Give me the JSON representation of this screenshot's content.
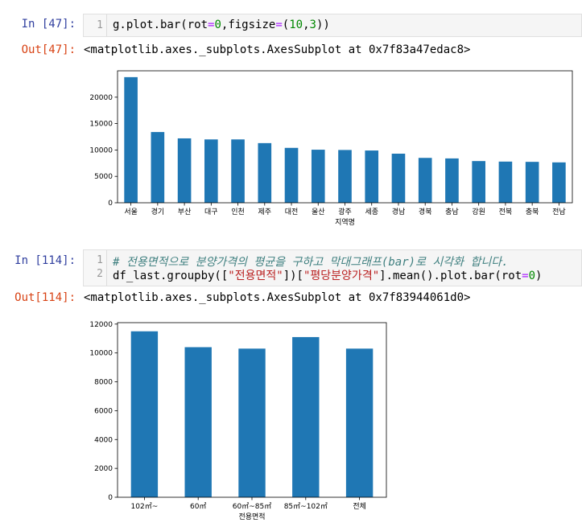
{
  "cells": [
    {
      "in_prompt": "In [47]:",
      "out_prompt": "Out[47]:",
      "line_numbers": [
        "1"
      ],
      "code_tokens": [
        [
          {
            "t": "g.plot.bar(rot",
            "c": ""
          },
          {
            "t": "=",
            "c": "op"
          },
          {
            "t": "0",
            "c": "num"
          },
          {
            "t": ",figsize",
            "c": ""
          },
          {
            "t": "=",
            "c": "op"
          },
          {
            "t": "(",
            "c": ""
          },
          {
            "t": "10",
            "c": "num"
          },
          {
            "t": ",",
            "c": ""
          },
          {
            "t": "3",
            "c": "num"
          },
          {
            "t": "))",
            "c": ""
          }
        ]
      ],
      "output_text": "<matplotlib.axes._subplots.AxesSubplot at 0x7f83a47edac8>"
    },
    {
      "in_prompt": "In [114]:",
      "out_prompt": "Out[114]:",
      "line_numbers": [
        "1",
        "2"
      ],
      "code_tokens": [
        [
          {
            "t": "# 전용면적으로 분양가격의 평균을 구하고 막대그래프(bar)로 시각화 합니다.",
            "c": "com"
          }
        ],
        [
          {
            "t": "df_last.groupby([",
            "c": ""
          },
          {
            "t": "\"전용면적\"",
            "c": "str"
          },
          {
            "t": "])[",
            "c": ""
          },
          {
            "t": "\"평당분양가격\"",
            "c": "str"
          },
          {
            "t": "].mean().plot.bar(rot",
            "c": ""
          },
          {
            "t": "=",
            "c": "op"
          },
          {
            "t": "0",
            "c": "num"
          },
          {
            "t": ")",
            "c": ""
          }
        ]
      ],
      "output_text": "<matplotlib.axes._subplots.AxesSubplot at 0x7f83944061d0>"
    }
  ],
  "colors": {
    "bar": "#1f77b4",
    "in_prompt": "#303f9f",
    "out_prompt": "#d84315"
  },
  "chart_data": [
    {
      "type": "bar",
      "categories": [
        "서울",
        "경기",
        "부산",
        "대구",
        "인천",
        "제주",
        "대전",
        "울산",
        "광주",
        "세종",
        "경남",
        "경북",
        "충남",
        "강원",
        "전북",
        "충북",
        "전남"
      ],
      "values": [
        23800,
        13400,
        12200,
        12000,
        12000,
        11300,
        10400,
        10050,
        10000,
        9900,
        9300,
        8500,
        8400,
        7900,
        7800,
        7750,
        7650
      ],
      "yticks": [
        0,
        5000,
        10000,
        15000,
        20000
      ],
      "ylim": [
        0,
        25000
      ],
      "xlabel": "지역명",
      "ylabel": ""
    },
    {
      "type": "bar",
      "categories": [
        "102㎡~",
        "60㎡",
        "60㎡~85㎡",
        "85㎡~102㎡",
        "전체"
      ],
      "values": [
        11500,
        10400,
        10300,
        11100,
        10300
      ],
      "yticks": [
        0,
        2000,
        4000,
        6000,
        8000,
        10000,
        12000
      ],
      "ylim": [
        0,
        12100
      ],
      "xlabel": "전용면적",
      "ylabel": ""
    }
  ]
}
